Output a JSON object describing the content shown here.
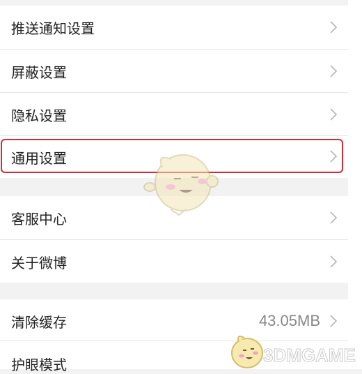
{
  "settings": {
    "group1": [
      {
        "label": "推送通知设置"
      },
      {
        "label": "屏蔽设置"
      },
      {
        "label": "隐私设置"
      },
      {
        "label": "通用设置"
      }
    ],
    "group2": [
      {
        "label": "客服中心"
      },
      {
        "label": "关于微博"
      }
    ],
    "group3": [
      {
        "label": "清除缓存",
        "value": "43.05MB"
      },
      {
        "label": "护眼模式"
      }
    ]
  },
  "colors": {
    "highlight": "#d02c3a",
    "background": "#f2f2f2",
    "row_text": "#222222",
    "value_text": "#888888"
  },
  "watermark": {
    "text": "3DMGAME"
  }
}
